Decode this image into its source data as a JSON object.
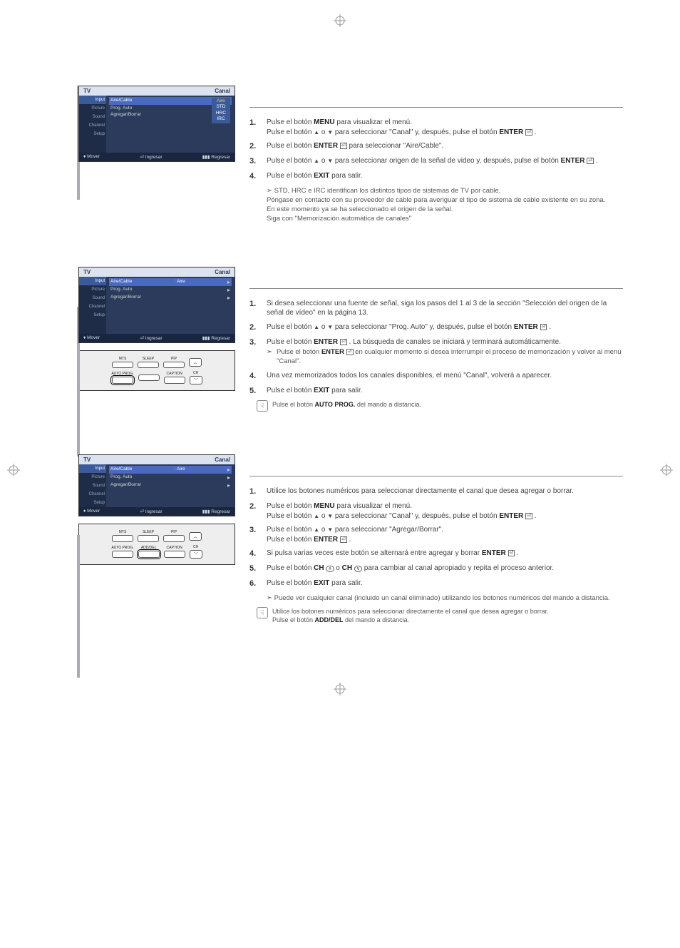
{
  "osd_common": {
    "tv": "TV",
    "title": "Canal",
    "side": [
      "Input",
      "Picture",
      "Sound",
      "Channel",
      "Setup"
    ],
    "foot_move": "Mover",
    "foot_enter": "Ingresar",
    "foot_return": "Regresar",
    "row_aircable": "Aire/Cable",
    "row_prog": "Prog. Auto",
    "row_add": "Agregar/Borrar",
    "val_aire": "Aire",
    "opts": [
      "Aire",
      "STD",
      "HRC",
      "IRC"
    ]
  },
  "remote": {
    "mts": "MTS",
    "sleep": "SLEEP",
    "pip": "PIP",
    "autoprog": "AUTO PROG.",
    "adddel": "ADD/DEL",
    "caption": "CAPTION",
    "ch": "CH"
  },
  "sec1": {
    "s1a": "Pulse el botón ",
    "s1b": "MENU",
    "s1c": " para visualizar el menú.",
    "s1d": "Pulse el botón ",
    "s1e": " o ",
    "s1f": " para seleccionar \"Canal\" y, después, pulse el botón ",
    "s1g": "ENTER",
    "s1h": " .",
    "s2a": "Pulse el botón ",
    "s2b": "ENTER",
    "s2c": " para seleccionar \"Aire/Cable\".",
    "s3a": "Pulse el botón ",
    "s3b": " o ",
    "s3c": " para seleccionar origen de la señal de video y, después, pulse el botón ",
    "s3d": "ENTER",
    "s3e": " .",
    "s4a": "Pulse el botón ",
    "s4b": "EXIT",
    "s4c": " para salir.",
    "n1": "STD, HRC e IRC identifican los distintos tipos de sistemas de TV por cable.",
    "n2": "Póngase en contacto con su proveedor de cable para averiguar el tipo de sistema de cable existente en su zona.",
    "n3": "En este momento ya se ha seleccionado el origen de la señal.",
    "n4": "Siga con \"Memorización automática de canales\""
  },
  "sec2": {
    "s1": "Si desea seleccionar una fuente de señal, siga los pasos del 1 al 3 de la sección \"Selección del origen de la señal de vídeo\" en la página 13.",
    "s2a": "Pulse el botón ",
    "s2b": " o ",
    "s2c": " para seleccionar \"Prog. Auto\" y, después, pulse el botón ",
    "s2d": "ENTER",
    "s2e": " .",
    "s3a": "Pulse el botón ",
    "s3b": "ENTER",
    "s3c": " . La búsqueda de canales se iniciará y terminará automáticamente.",
    "s3sub_a": "Pulse el botón ",
    "s3sub_b": "ENTER",
    "s3sub_c": " en cualquier momento si desea interrumpir el proceso de memorización y volver al menú \"Canal\".",
    "s4": "Una vez memorizados todos los canales disponibles, el menú \"Canal\", volverá a aparecer.",
    "s5a": "Pulse el botón ",
    "s5b": "EXIT",
    "s5c": " para salir.",
    "tip_a": "Pulse el botón ",
    "tip_b": "AUTO PROG.",
    "tip_c": " del mando a distancia."
  },
  "sec3": {
    "s1": "Utilice los botones numéricos para seleccionar directamente el canal que desea agregar o borrar.",
    "s2a": "Pulse el botón ",
    "s2b": "MENU",
    "s2c": " para visualizar el menú.",
    "s2d": "Pulse el botón ",
    "s2e": " o ",
    "s2f": " para seleccionar \"Canal\" y, después, pulse el botón ",
    "s2g": "ENTER",
    "s2h": " .",
    "s3a": "Pulse el botón ",
    "s3b": " o ",
    "s3c": " para seleccionar \"Agregar/Borrar\".",
    "s3d": "Pulse el botón ",
    "s3e": "ENTER",
    "s3f": " .",
    "s4a": "Si pulsa varias veces este botón se alternará entre agregar y borrar ",
    "s4b": "ENTER",
    "s4c": " .",
    "s5a": "Pulse el botón ",
    "s5b": "CH",
    "s5c": " o ",
    "s5d": "CH",
    "s5e": " para cambiar al canal apropiado y repita el proceso anterior.",
    "s6a": "Pulse el botón ",
    "s6b": "EXIT",
    "s6c": " para salir.",
    "n1": "Puede ver cualquier canal (incluido un canal eliminado) utilizando los botones numéricos del mando a distancia.",
    "tip1": "Utilice los botones numéricos para seleccionar directamente el canal que desea agregar o borrar.",
    "tip2a": "Pulse el botón ",
    "tip2b": "ADD/DEL",
    "tip2c": " del mando a distancia."
  }
}
